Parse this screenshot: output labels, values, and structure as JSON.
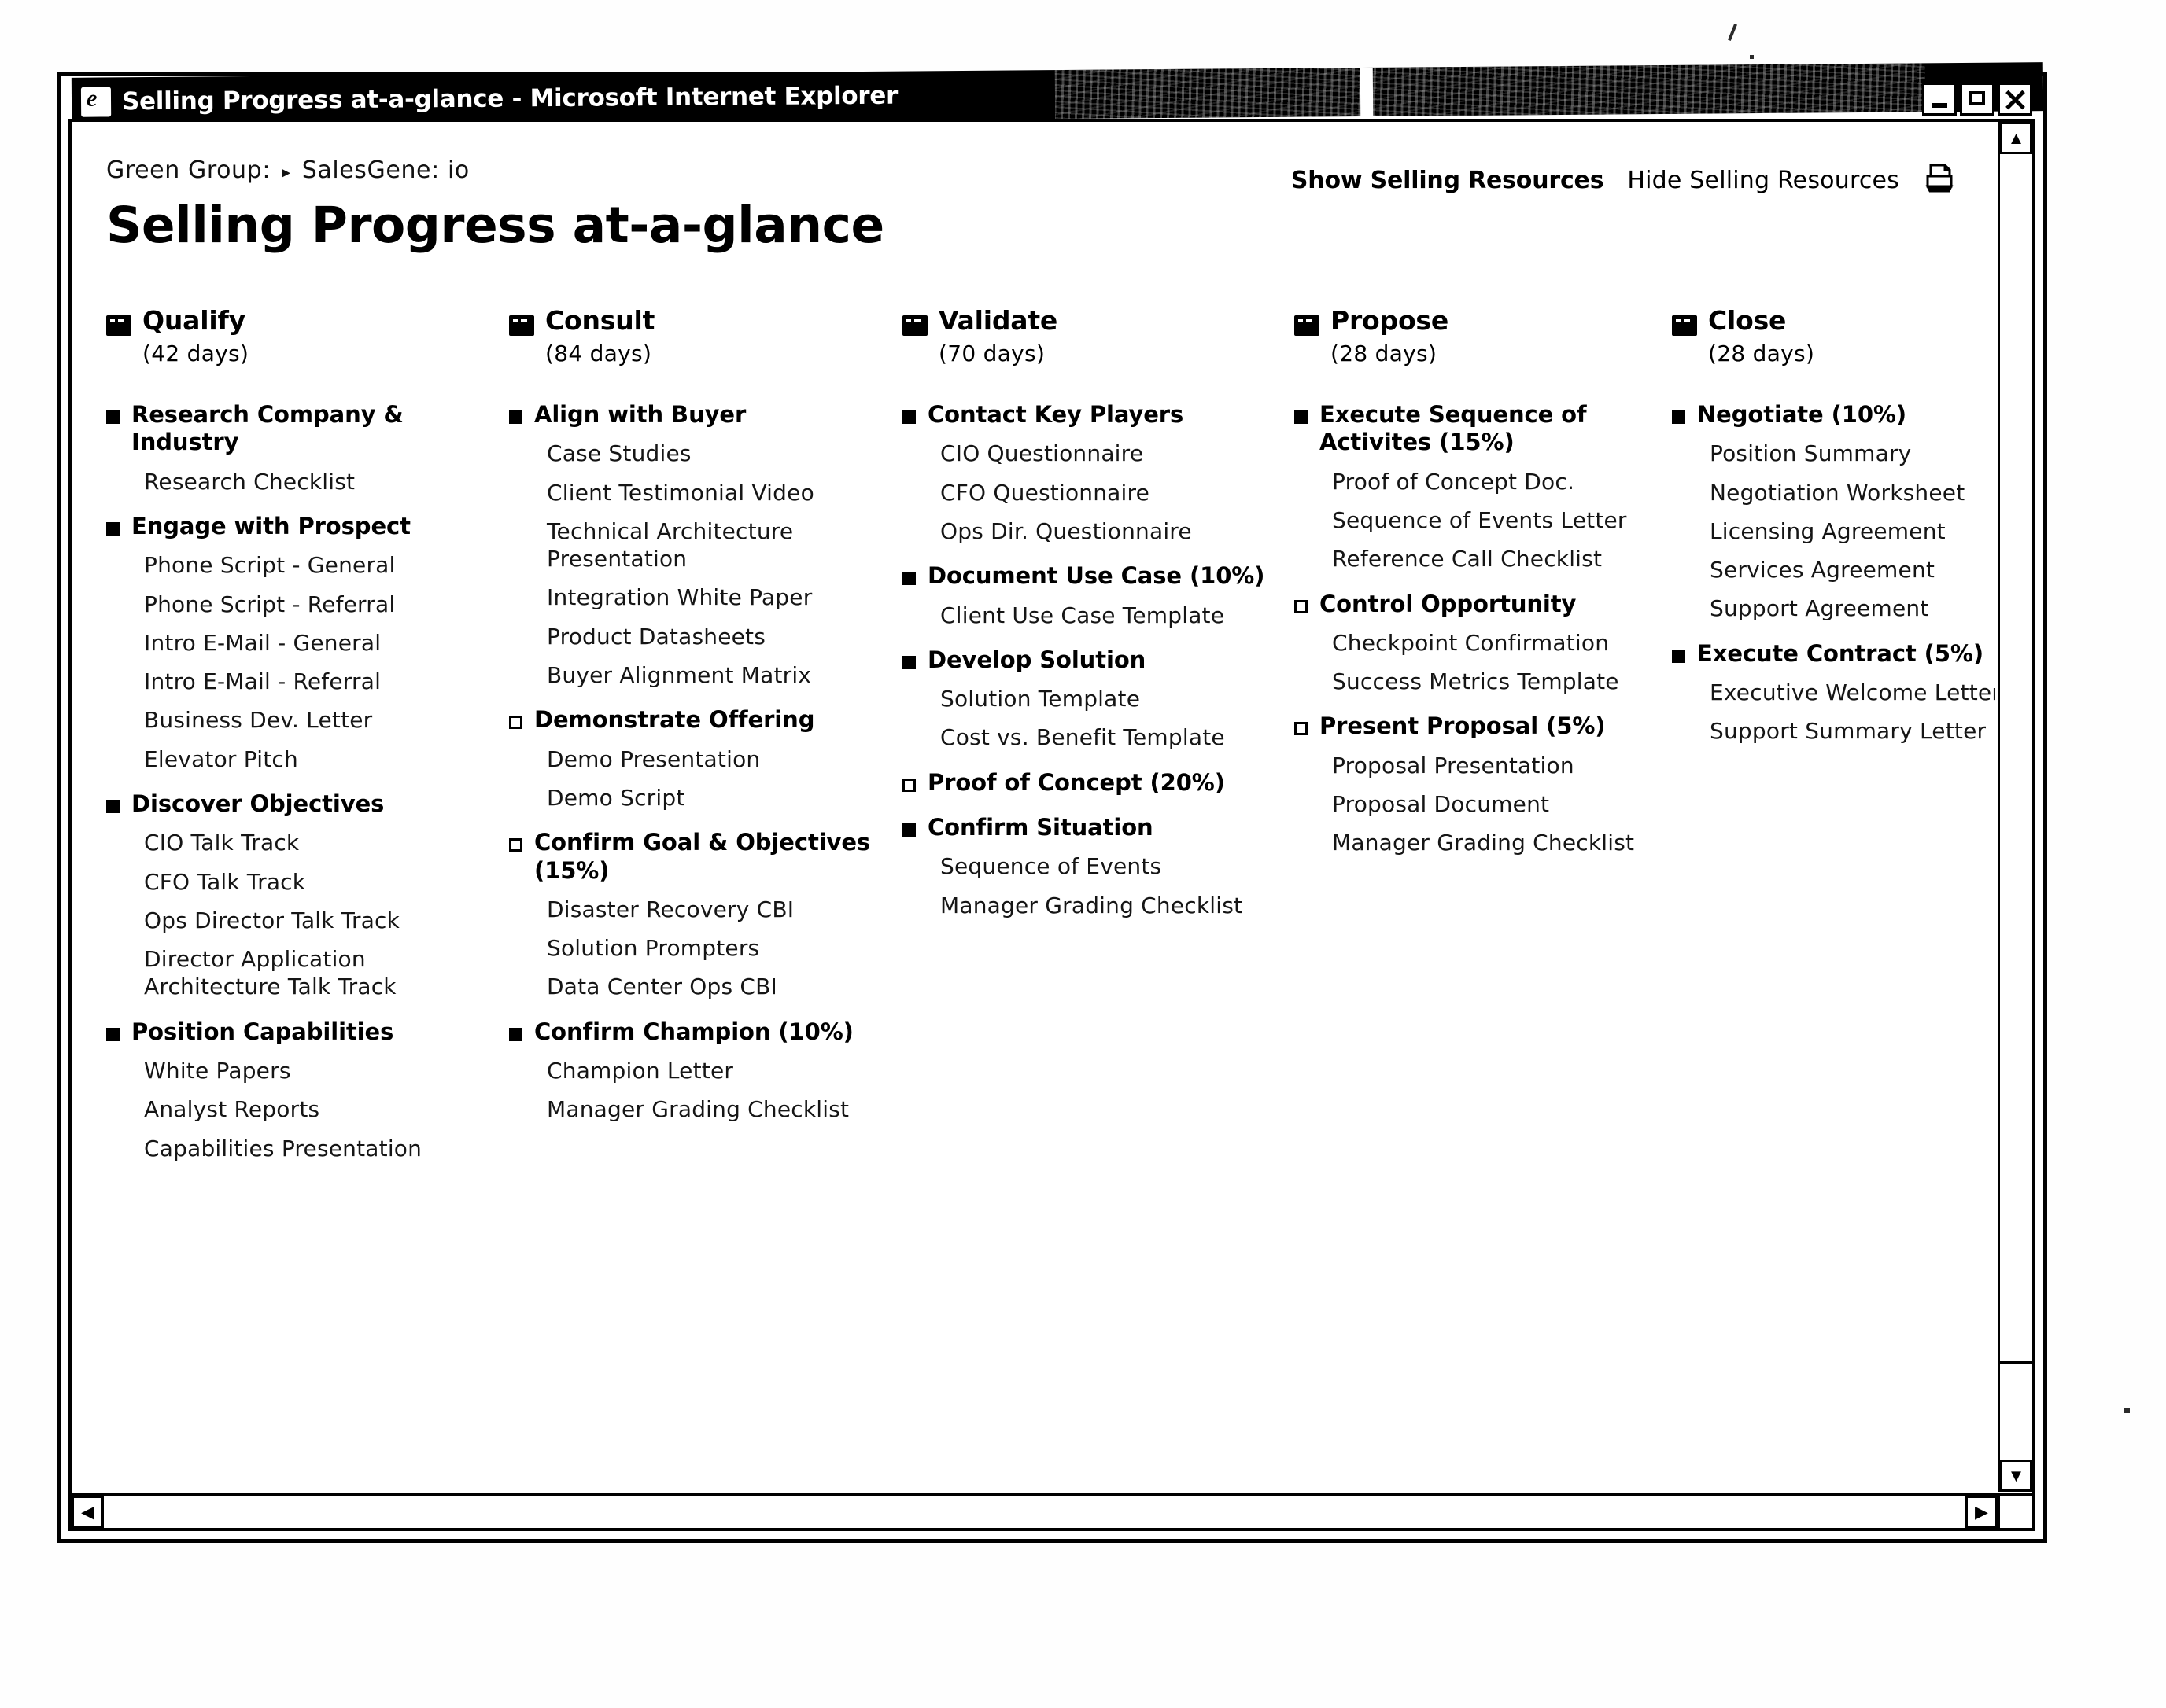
{
  "window": {
    "title": "Selling Progress at-a-glance - Microsoft Internet Explorer",
    "icon": "ie-icon",
    "controls": {
      "minimize": "minimize-button",
      "maximize": "maximize-button",
      "close": "close-button"
    }
  },
  "breadcrumb": {
    "root": "Green Group:",
    "separator": "▸",
    "current": "SalesGene: io"
  },
  "header": {
    "title": "Selling Progress at-a-glance",
    "show_resources": "Show Selling Resources",
    "hide_resources": "Hide Selling Resources",
    "print_icon": "printer-icon"
  },
  "scrollbars": {
    "up_arrow": "▲",
    "down_arrow": "▼",
    "left_arrow": "◀",
    "right_arrow": "▶"
  },
  "stages": [
    {
      "name": "Qualify",
      "days": "(42 days)",
      "activities": [
        {
          "title": "Research Company & Industry",
          "bullet": "filled",
          "resources": [
            "Research Checklist"
          ]
        },
        {
          "title": "Engage with Prospect",
          "bullet": "filled",
          "resources": [
            "Phone Script - General",
            "Phone Script - Referral",
            "Intro E-Mail - General",
            "Intro E-Mail - Referral",
            "Business Dev. Letter",
            "Elevator Pitch"
          ]
        },
        {
          "title": "Discover Objectives",
          "bullet": "filled",
          "resources": [
            "CIO Talk Track",
            "CFO Talk Track",
            "Ops Director Talk Track",
            "Director Application Architecture Talk Track"
          ]
        },
        {
          "title": "Position Capabilities",
          "bullet": "filled",
          "resources": [
            "White Papers",
            "Analyst Reports",
            "Capabilities Presentation"
          ]
        }
      ]
    },
    {
      "name": "Consult",
      "days": "(84 days)",
      "activities": [
        {
          "title": "Align with Buyer",
          "bullet": "filled",
          "resources": [
            "Case Studies",
            "Client Testimonial Video",
            "Technical Architecture Presentation",
            "Integration White Paper",
            "Product Datasheets",
            "Buyer Alignment Matrix"
          ]
        },
        {
          "title": "Demonstrate Offering",
          "bullet": "hollow",
          "resources": [
            "Demo Presentation",
            "Demo Script"
          ]
        },
        {
          "title": "Confirm Goal & Objectives (15%)",
          "bullet": "hollow",
          "resources": [
            "Disaster Recovery CBI",
            "Solution Prompters",
            "Data Center Ops CBI"
          ]
        },
        {
          "title": "Confirm Champion (10%)",
          "bullet": "filled",
          "resources": [
            "Champion Letter",
            "Manager Grading Checklist"
          ]
        }
      ]
    },
    {
      "name": "Validate",
      "days": "(70 days)",
      "activities": [
        {
          "title": "Contact Key Players",
          "bullet": "filled",
          "resources": [
            "CIO Questionnaire",
            "CFO Questionnaire",
            "Ops Dir. Questionnaire"
          ]
        },
        {
          "title": "Document Use Case (10%)",
          "bullet": "filled",
          "resources": [
            "Client Use Case Template"
          ]
        },
        {
          "title": "Develop Solution",
          "bullet": "filled",
          "resources": [
            "Solution Template",
            "Cost vs. Benefit Template"
          ]
        },
        {
          "title": "Proof of Concept (20%)",
          "bullet": "hollow",
          "resources": []
        },
        {
          "title": "Confirm Situation",
          "bullet": "filled",
          "resources": [
            "Sequence of Events",
            "Manager Grading Checklist"
          ]
        }
      ]
    },
    {
      "name": "Propose",
      "days": "(28 days)",
      "activities": [
        {
          "title": "Execute Sequence of Activites (15%)",
          "bullet": "filled",
          "resources": [
            "Proof of Concept Doc.",
            "Sequence of Events Letter",
            "Reference Call Checklist"
          ]
        },
        {
          "title": "Control Opportunity",
          "bullet": "hollow",
          "resources": [
            "Checkpoint Confirmation",
            "Success Metrics Template"
          ]
        },
        {
          "title": "Present Proposal (5%)",
          "bullet": "hollow",
          "resources": [
            "Proposal Presentation",
            "Proposal Document",
            "Manager Grading Checklist"
          ]
        }
      ]
    },
    {
      "name": "Close",
      "days": "(28 days)",
      "activities": [
        {
          "title": "Negotiate (10%)",
          "bullet": "filled",
          "resources": [
            "Position Summary",
            "Negotiation Worksheet",
            "Licensing Agreement",
            "Services Agreement",
            "Support Agreement"
          ]
        },
        {
          "title": "Execute Contract (5%)",
          "bullet": "filled",
          "resources": [
            "Executive Welcome Letter",
            "Support Summary Letter"
          ]
        }
      ]
    }
  ]
}
